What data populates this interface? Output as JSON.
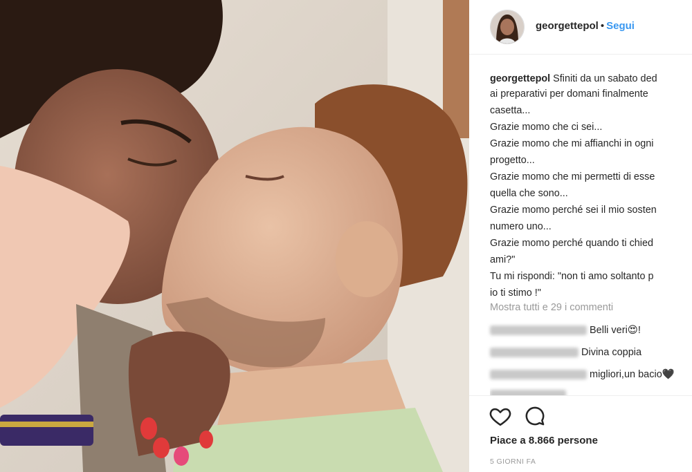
{
  "post": {
    "username": "georgettepol",
    "follow_label": "Segui",
    "separator": "•"
  },
  "caption": {
    "username": "georgettepol",
    "lines": [
      "Sfiniti da un sabato ded",
      "ai preparativi per domani finalmente",
      "casetta...",
      "Grazie momo che ci sei...",
      "Grazie momo che mi affianchi in ogni",
      "progetto...",
      "Grazie momo che mi permetti di esse",
      "quella che sono...",
      "Grazie momo perché sei il mio sosten",
      "numero uno...",
      "Grazie momo perché quando ti chied",
      "ami?\"",
      "Tu mi rispondi: \"non ti amo soltanto p",
      "io ti stimo !\""
    ]
  },
  "comments": {
    "view_all": "Mostra tutti e 29 i commenti",
    "items": [
      {
        "text": "Belli veri😍!"
      },
      {
        "text": "Divina coppia"
      },
      {
        "text": "migliori,un bacio🖤"
      }
    ]
  },
  "actions": {
    "heart_icon": "heart-outline-icon",
    "comment_icon": "comment-bubble-icon"
  },
  "likes": "Piace a 8.866 persone",
  "date": "5 GIORNI FA"
}
